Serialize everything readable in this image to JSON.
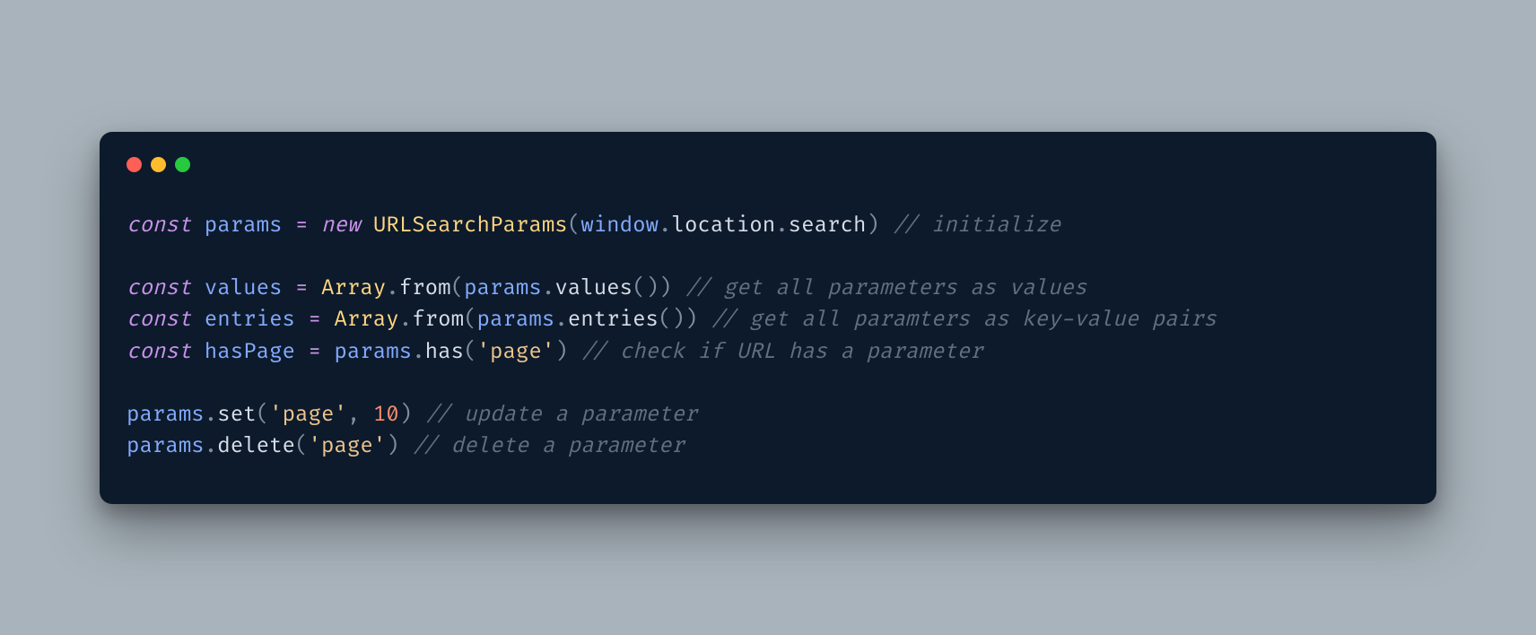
{
  "colors": {
    "background_page": "#a8b3bb",
    "background_window": "#0d1a2b",
    "traffic_red": "#ff5f56",
    "traffic_yellow": "#ffbd2e",
    "traffic_green": "#27c93f",
    "keyword": "#c792ea",
    "identifier": "#82aaff",
    "class": "#ffd580",
    "default": "#d7dee8",
    "punctuation": "#7f8ea3",
    "string": "#ecc48d",
    "number": "#f78c6c",
    "comment": "#607080"
  },
  "code": {
    "language": "javascript",
    "lines": [
      {
        "tokens": [
          {
            "t": "const",
            "c": "kw"
          },
          {
            "t": " ",
            "c": "punc"
          },
          {
            "t": "params",
            "c": "var"
          },
          {
            "t": " ",
            "c": "punc"
          },
          {
            "t": "=",
            "c": "op"
          },
          {
            "t": " ",
            "c": "punc"
          },
          {
            "t": "new",
            "c": "kw"
          },
          {
            "t": " ",
            "c": "punc"
          },
          {
            "t": "URLSearchParams",
            "c": "class"
          },
          {
            "t": "(",
            "c": "punc"
          },
          {
            "t": "window",
            "c": "var"
          },
          {
            "t": ".",
            "c": "punc"
          },
          {
            "t": "location",
            "c": "prop"
          },
          {
            "t": ".",
            "c": "punc"
          },
          {
            "t": "search",
            "c": "prop"
          },
          {
            "t": ")",
            "c": "punc"
          },
          {
            "t": " ",
            "c": "punc"
          },
          {
            "t": "// initialize",
            "c": "comment"
          }
        ]
      },
      {
        "tokens": [
          {
            "t": "",
            "c": "punc"
          }
        ]
      },
      {
        "tokens": [
          {
            "t": "const",
            "c": "kw"
          },
          {
            "t": " ",
            "c": "punc"
          },
          {
            "t": "values",
            "c": "var"
          },
          {
            "t": " ",
            "c": "punc"
          },
          {
            "t": "=",
            "c": "op"
          },
          {
            "t": " ",
            "c": "punc"
          },
          {
            "t": "Array",
            "c": "class"
          },
          {
            "t": ".",
            "c": "punc"
          },
          {
            "t": "from",
            "c": "func"
          },
          {
            "t": "(",
            "c": "punc"
          },
          {
            "t": "params",
            "c": "var"
          },
          {
            "t": ".",
            "c": "punc"
          },
          {
            "t": "values",
            "c": "func"
          },
          {
            "t": "())",
            "c": "punc"
          },
          {
            "t": " ",
            "c": "punc"
          },
          {
            "t": "// get all parameters as values",
            "c": "comment"
          }
        ]
      },
      {
        "tokens": [
          {
            "t": "const",
            "c": "kw"
          },
          {
            "t": " ",
            "c": "punc"
          },
          {
            "t": "entries",
            "c": "var"
          },
          {
            "t": " ",
            "c": "punc"
          },
          {
            "t": "=",
            "c": "op"
          },
          {
            "t": " ",
            "c": "punc"
          },
          {
            "t": "Array",
            "c": "class"
          },
          {
            "t": ".",
            "c": "punc"
          },
          {
            "t": "from",
            "c": "func"
          },
          {
            "t": "(",
            "c": "punc"
          },
          {
            "t": "params",
            "c": "var"
          },
          {
            "t": ".",
            "c": "punc"
          },
          {
            "t": "entries",
            "c": "func"
          },
          {
            "t": "())",
            "c": "punc"
          },
          {
            "t": " ",
            "c": "punc"
          },
          {
            "t": "// get all paramters as key-value pairs",
            "c": "comment"
          }
        ]
      },
      {
        "tokens": [
          {
            "t": "const",
            "c": "kw"
          },
          {
            "t": " ",
            "c": "punc"
          },
          {
            "t": "hasPage",
            "c": "var"
          },
          {
            "t": " ",
            "c": "punc"
          },
          {
            "t": "=",
            "c": "op"
          },
          {
            "t": " ",
            "c": "punc"
          },
          {
            "t": "params",
            "c": "var"
          },
          {
            "t": ".",
            "c": "punc"
          },
          {
            "t": "has",
            "c": "func"
          },
          {
            "t": "(",
            "c": "punc"
          },
          {
            "t": "'page'",
            "c": "str"
          },
          {
            "t": ")",
            "c": "punc"
          },
          {
            "t": " ",
            "c": "punc"
          },
          {
            "t": "// check if URL has a parameter",
            "c": "comment"
          }
        ]
      },
      {
        "tokens": [
          {
            "t": "",
            "c": "punc"
          }
        ]
      },
      {
        "tokens": [
          {
            "t": "params",
            "c": "var"
          },
          {
            "t": ".",
            "c": "punc"
          },
          {
            "t": "set",
            "c": "func"
          },
          {
            "t": "(",
            "c": "punc"
          },
          {
            "t": "'page'",
            "c": "str"
          },
          {
            "t": ",",
            "c": "punc"
          },
          {
            "t": " ",
            "c": "punc"
          },
          {
            "t": "10",
            "c": "num"
          },
          {
            "t": ")",
            "c": "punc"
          },
          {
            "t": " ",
            "c": "punc"
          },
          {
            "t": "// update a parameter",
            "c": "comment"
          }
        ]
      },
      {
        "tokens": [
          {
            "t": "params",
            "c": "var"
          },
          {
            "t": ".",
            "c": "punc"
          },
          {
            "t": "delete",
            "c": "func"
          },
          {
            "t": "(",
            "c": "punc"
          },
          {
            "t": "'page'",
            "c": "str"
          },
          {
            "t": ")",
            "c": "punc"
          },
          {
            "t": " ",
            "c": "punc"
          },
          {
            "t": "// delete a parameter",
            "c": "comment"
          }
        ]
      }
    ]
  }
}
